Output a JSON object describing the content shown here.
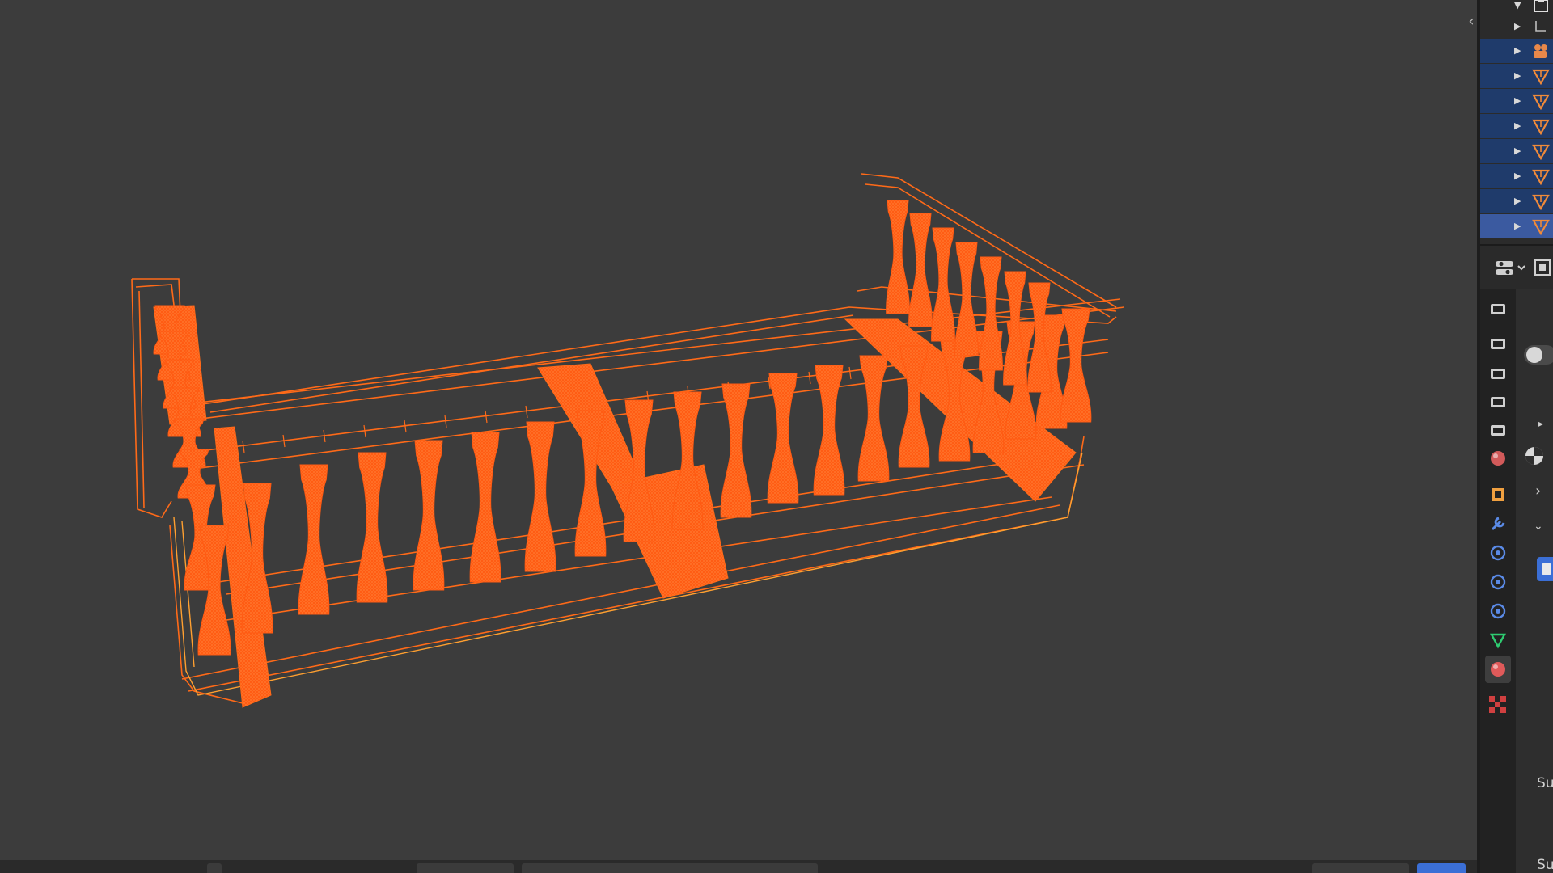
{
  "colors": {
    "viewport_bg": "#3c3c3c",
    "selected_wire": "#ff5a12",
    "active_wire": "#ff9a2a",
    "outliner_selected": "#1f3b6b",
    "outliner_active": "#3b5aa0"
  },
  "viewport": {
    "collapse_icon": "chevron-left-icon",
    "object": "wireframe-balustrade"
  },
  "outliner": {
    "rows": [
      {
        "icon": "collection-icon"
      },
      {
        "icon": "child-icon"
      },
      {
        "icon": "camera-icon",
        "selected": true
      },
      {
        "icon": "mesh-icon",
        "selected": true
      },
      {
        "icon": "mesh-icon",
        "selected": true
      },
      {
        "icon": "mesh-icon",
        "selected": true
      },
      {
        "icon": "mesh-icon",
        "selected": true
      },
      {
        "icon": "mesh-icon",
        "selected": true
      },
      {
        "icon": "mesh-icon",
        "selected": true
      },
      {
        "icon": "mesh-icon",
        "active": true
      }
    ]
  },
  "properties": {
    "tabs": [
      "tool-icon",
      "render-icon",
      "output-icon",
      "view-layer-icon",
      "scene-icon",
      "world-icon",
      "object-icon",
      "modifier-icon",
      "particles-icon",
      "physics-icon",
      "constraints-icon",
      "data-icon",
      "material-icon",
      "texture-icon"
    ],
    "active_tab": "material-icon",
    "content_labels": [
      "Su",
      "Su"
    ]
  }
}
